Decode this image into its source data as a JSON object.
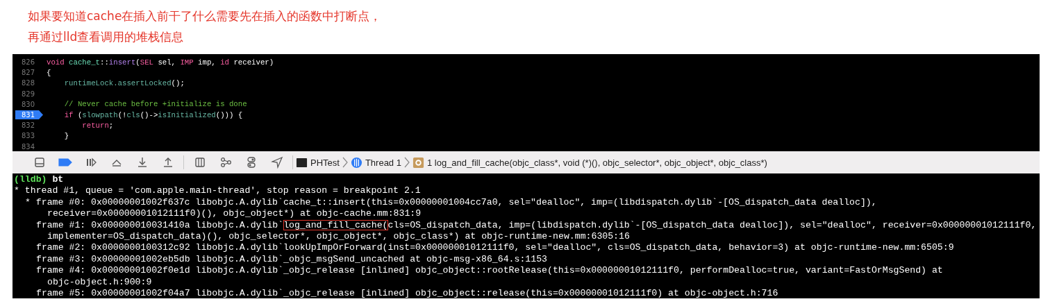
{
  "note": {
    "lines": [
      "如果要知道cache在插入前干了什么需要先在插入的函数中打断点，",
      "再通过lld查看调用的堆栈信息"
    ]
  },
  "editor": {
    "lines": [
      {
        "number": "826",
        "current": false,
        "tokens": [
          {
            "kind": "keyword",
            "text": "void "
          },
          {
            "kind": "type",
            "text": "cache_t"
          },
          {
            "kind": "plain",
            "text": "::"
          },
          {
            "kind": "function",
            "text": "insert"
          },
          {
            "kind": "plain",
            "text": "("
          },
          {
            "kind": "keyword",
            "text": "SEL"
          },
          {
            "kind": "plain",
            "text": " sel, "
          },
          {
            "kind": "keyword",
            "text": "IMP"
          },
          {
            "kind": "plain",
            "text": " imp, "
          },
          {
            "kind": "keyword",
            "text": "id"
          },
          {
            "kind": "plain",
            "text": " receiver)"
          }
        ]
      },
      {
        "number": "827",
        "current": false,
        "tokens": [
          {
            "kind": "plain",
            "text": "{"
          }
        ]
      },
      {
        "number": "828",
        "current": false,
        "tokens": [
          {
            "kind": "call",
            "text": "    runtimeLock.assertLocked"
          },
          {
            "kind": "plain",
            "text": "();"
          }
        ]
      },
      {
        "number": "829",
        "current": false
      },
      {
        "number": "830",
        "current": false,
        "tokens": [
          {
            "kind": "comment",
            "text": "    // Never cache before +initialize is done"
          }
        ]
      },
      {
        "number": "831",
        "current": true,
        "tokens": [
          {
            "kind": "keyword",
            "text": "    if"
          },
          {
            "kind": "plain",
            "text": " ("
          },
          {
            "kind": "call",
            "text": "slowpath"
          },
          {
            "kind": "plain",
            "text": "(!"
          },
          {
            "kind": "call",
            "text": "cls"
          },
          {
            "kind": "plain",
            "text": "()->"
          },
          {
            "kind": "call",
            "text": "isInitialized"
          },
          {
            "kind": "plain",
            "text": "())) {"
          }
        ]
      },
      {
        "number": "832",
        "current": false,
        "tokens": [
          {
            "kind": "keyword",
            "text": "        return"
          },
          {
            "kind": "plain",
            "text": ";"
          }
        ]
      },
      {
        "number": "833",
        "current": false,
        "tokens": [
          {
            "kind": "plain",
            "text": "    }"
          }
        ]
      },
      {
        "number": "834",
        "current": false
      }
    ]
  },
  "debug_bar": {
    "breakpoints_active": true,
    "breadcrumbs": [
      {
        "kind": "app",
        "label": "PHTest"
      },
      {
        "kind": "thread",
        "label": "Thread 1"
      },
      {
        "kind": "frame",
        "label": "1 log_and_fill_cache(objc_class*, void (*)(), objc_selector*, objc_object*, objc_class*)"
      }
    ]
  },
  "console": {
    "lines": [
      {
        "kind": "command",
        "segments": [
          {
            "text": "(lldb) "
          },
          {
            "text": "bt"
          }
        ]
      },
      {
        "kind": "thread",
        "segments": [
          {
            "text": "* thread #1, queue = 'com.apple.main-thread', stop reason = breakpoint 2.1"
          }
        ]
      },
      {
        "kind": "current-frame",
        "segments": [
          {
            "text": "* frame #0: 0x00000001002f637c libobjc.A.dylib`cache_t::insert(this=0x00000001004cc7a0, sel=\"dealloc\", imp=(libdispatch.dylib`-[OS_dispatch_data dealloc]),"
          }
        ]
      },
      {
        "kind": "continuation",
        "segments": [
          {
            "text": "receiver=0x00000001012111f0)(), objc_object*) at objc-cache.mm:831:9"
          }
        ]
      },
      {
        "kind": "frame",
        "segments": [
          {
            "text": "frame #1: 0x000000010031410a libobjc.A.dylib`",
            "boxed": false
          },
          {
            "text": "log_and_fill_cache(",
            "boxed": true
          },
          {
            "text": "cls=OS_dispatch_data, imp=(libdispatch.dylib`-[OS_dispatch_data dealloc]), sel=\"dealloc\", receiver=0x00000001012111f0,",
            "boxed": false
          }
        ]
      },
      {
        "kind": "continuation",
        "segments": [
          {
            "text": "implementer=OS_dispatch_data)(), objc_selector*, objc_object*, objc_class*) at objc-runtime-new.mm:6305:16"
          }
        ]
      },
      {
        "kind": "frame",
        "segments": [
          {
            "text": "frame #2: 0x0000000100312c92 libobjc.A.dylib`lookUpImpOrForward(inst=0x00000001012111f0, sel=\"dealloc\", cls=OS_dispatch_data, behavior=3) at objc-runtime-new.mm:6505:9"
          }
        ]
      },
      {
        "kind": "frame",
        "segments": [
          {
            "text": "frame #3: 0x00000001002eb5db libobjc.A.dylib`_objc_msgSend_uncached at objc-msg-x86_64.s:1153"
          }
        ]
      },
      {
        "kind": "frame",
        "segments": [
          {
            "text": "frame #4: 0x00000001002f0e1d libobjc.A.dylib`_objc_release [inlined] objc_object::rootRelease(this=0x00000001012111f0, performDealloc=true, variant=FastOrMsgSend) at"
          }
        ]
      },
      {
        "kind": "continuation",
        "segments": [
          {
            "text": "objc-object.h:900:9"
          }
        ]
      },
      {
        "kind": "frame",
        "segments": [
          {
            "text": "frame #5: 0x00000001002f04a7 libobjc.A.dylib`_objc_release [inlined] objc_object::release(this=0x00000001012111f0) at objc-object.h:716"
          }
        ]
      }
    ]
  }
}
